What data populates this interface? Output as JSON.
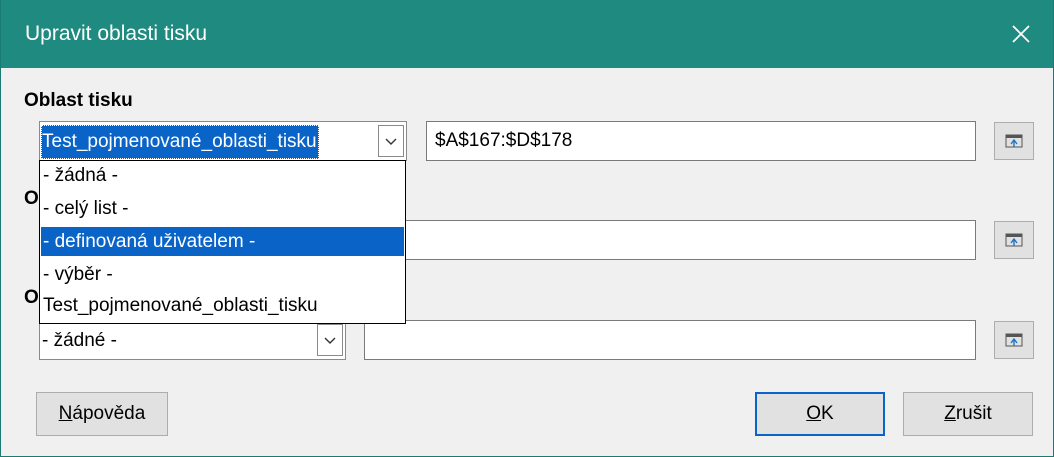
{
  "dialog": {
    "title": "Upravit oblasti tisku"
  },
  "print_range": {
    "label": "Oblast tisku",
    "combo_value": "Test_pojmenované_oblasti_tisku",
    "range_value": "$A$167:$D$178"
  },
  "dropdown": {
    "options": [
      "- žádná -",
      "- celý list -",
      "- definovaná uživatelem -",
      "- výběr -",
      "Test_pojmenované_oblasti_tisku"
    ],
    "highlighted_index": 2
  },
  "rows_to_repeat": {
    "label_visible": "O",
    "range_value": ""
  },
  "columns_to_repeat": {
    "label_visible": "O",
    "combo_value": "- žádné -",
    "range_value": ""
  },
  "buttons": {
    "help_first": "N",
    "help_rest": "ápověda",
    "ok_first": "O",
    "ok_rest": "K",
    "cancel_first": "Z",
    "cancel_rest": "rušit"
  },
  "icons": {
    "close": "close-icon",
    "dropdown": "chevron-down-icon",
    "shrink": "shrink-dialog-icon"
  },
  "colors": {
    "titlebar": "#1f8a7f",
    "selection": "#0a64c8"
  }
}
